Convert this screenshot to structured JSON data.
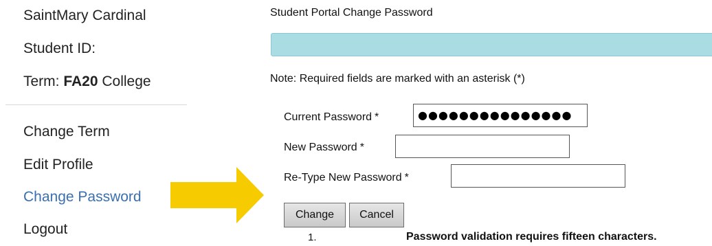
{
  "sidebar": {
    "user_name": "SaintMary Cardinal",
    "student_id_label": "Student ID:",
    "term_prefix": "Term: ",
    "term_code": "FA20",
    "term_suffix": " College",
    "nav": [
      {
        "label": "Change Term"
      },
      {
        "label": "Edit Profile"
      },
      {
        "label": "Change Password",
        "active": true
      },
      {
        "label": "Logout"
      }
    ]
  },
  "main": {
    "title": "Student Portal Change Password",
    "note": "Note: Required fields are marked with an asterisk (*)",
    "fields": {
      "current": {
        "label": "Current Password",
        "required_mark": "*",
        "value": "●●●●●●●●●●●●●●●"
      },
      "new": {
        "label": "New Password",
        "required_mark": "*",
        "value": ""
      },
      "retype": {
        "label": "Re-Type New Password",
        "required_mark": "*",
        "value": ""
      }
    },
    "buttons": {
      "change": "Change",
      "cancel": "Cancel"
    },
    "rules": [
      {
        "number": "1.",
        "text": "Password validation requires fifteen characters."
      }
    ]
  },
  "colors": {
    "info_bar": "#a9dce3",
    "active_link": "#3a6fb0",
    "arrow": "#f6cb00"
  },
  "icons": {
    "pointer_arrow": "right-arrow-icon"
  }
}
